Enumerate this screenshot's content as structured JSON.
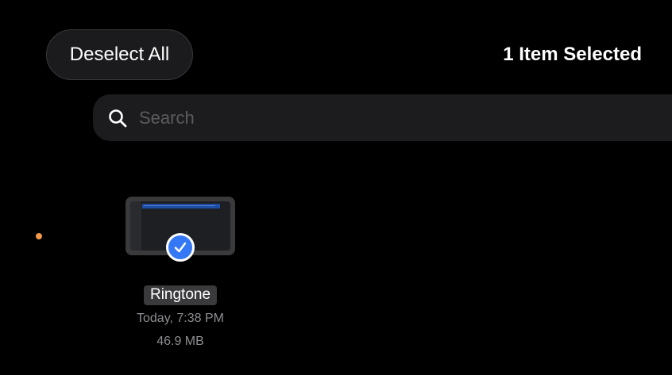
{
  "header": {
    "deselect_label": "Deselect All",
    "selection_count": "1 Item Selected"
  },
  "search": {
    "placeholder": "Search",
    "icon": "search-icon"
  },
  "tag": {
    "color": "#f2994a"
  },
  "files": [
    {
      "name": "Ringtone",
      "date": "Today, 7:38 PM",
      "size": "46.9 MB",
      "selected": true,
      "icon": "checkmark-icon",
      "accent": "#3478f6"
    }
  ]
}
